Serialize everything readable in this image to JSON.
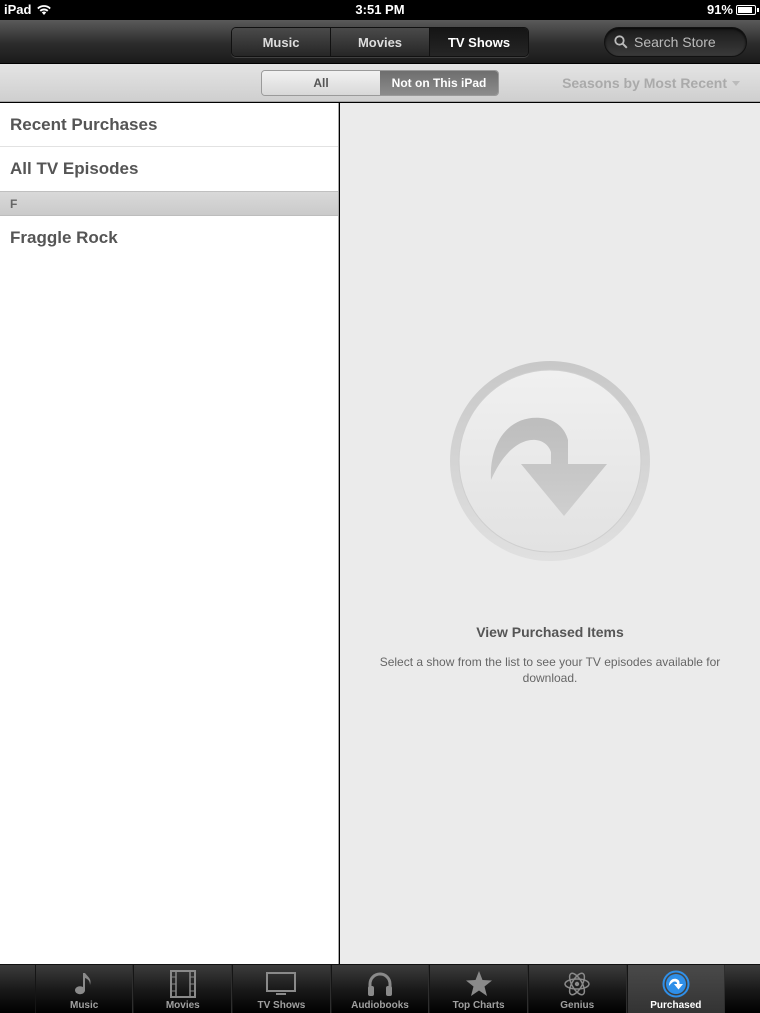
{
  "status": {
    "device": "iPad",
    "time": "3:51 PM",
    "battery": "91%",
    "battery_level": 0.91
  },
  "nav": {
    "segments": [
      "Music",
      "Movies",
      "TV Shows"
    ],
    "active_segment": "TV Shows",
    "search_placeholder": "Search Store"
  },
  "filter": {
    "options": [
      "All",
      "Not on This iPad"
    ],
    "active": "Not on This iPad",
    "sort_label": "Seasons by Most Recent"
  },
  "list": {
    "recent": "Recent Purchases",
    "all_episodes": "All TV Episodes",
    "section_letter": "F",
    "shows": [
      "Fraggle Rock"
    ]
  },
  "detail": {
    "title": "View Purchased Items",
    "description": "Select a show from the list to see your TV episodes available for download."
  },
  "tabs": [
    {
      "label": "Music",
      "icon": "music-note-icon"
    },
    {
      "label": "Movies",
      "icon": "film-icon"
    },
    {
      "label": "TV Shows",
      "icon": "tv-icon"
    },
    {
      "label": "Audiobooks",
      "icon": "headphones-icon"
    },
    {
      "label": "Top Charts",
      "icon": "star-icon"
    },
    {
      "label": "Genius",
      "icon": "atom-icon"
    },
    {
      "label": "Purchased",
      "icon": "purchased-icon"
    }
  ],
  "active_tab": "Purchased",
  "colors": {
    "accent_blue": "#2f8fe8",
    "panel_bg": "#ebebeb"
  }
}
